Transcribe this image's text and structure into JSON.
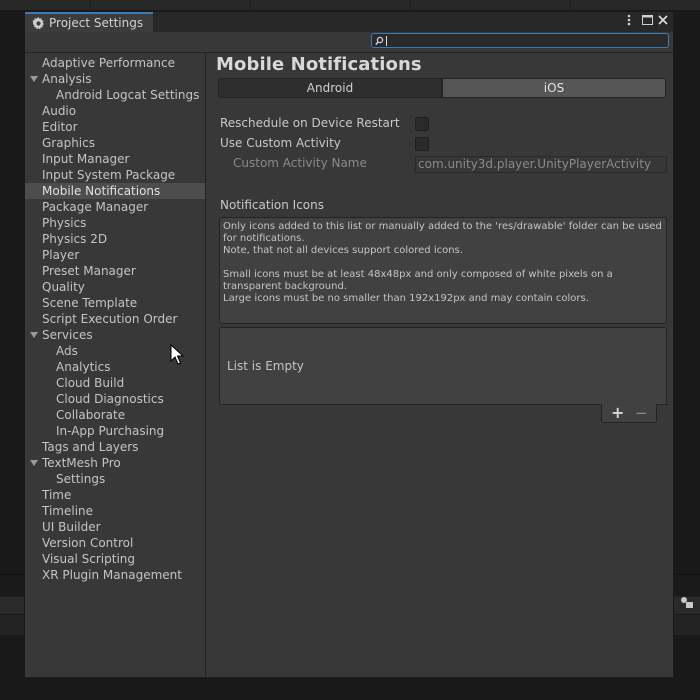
{
  "window": {
    "title": "Project Settings",
    "menu_icon": "more-vert-icon",
    "maximize_icon": "maximize-icon",
    "close_icon": "close-icon"
  },
  "search": {
    "value": "",
    "placeholder": ""
  },
  "sidebar": {
    "items": [
      {
        "label": "Adaptive Performance"
      },
      {
        "label": "Analysis",
        "expanded": true
      },
      {
        "label": "Android Logcat Settings"
      },
      {
        "label": "Audio"
      },
      {
        "label": "Editor"
      },
      {
        "label": "Graphics"
      },
      {
        "label": "Input Manager"
      },
      {
        "label": "Input System Package"
      },
      {
        "label": "Mobile Notifications",
        "selected": true
      },
      {
        "label": "Package Manager"
      },
      {
        "label": "Physics"
      },
      {
        "label": "Physics 2D"
      },
      {
        "label": "Player"
      },
      {
        "label": "Preset Manager"
      },
      {
        "label": "Quality"
      },
      {
        "label": "Scene Template"
      },
      {
        "label": "Script Execution Order"
      },
      {
        "label": "Services",
        "expanded": true
      },
      {
        "label": "Ads"
      },
      {
        "label": "Analytics"
      },
      {
        "label": "Cloud Build"
      },
      {
        "label": "Cloud Diagnostics"
      },
      {
        "label": "Collaborate"
      },
      {
        "label": "In-App Purchasing"
      },
      {
        "label": "Tags and Layers"
      },
      {
        "label": "TextMesh Pro",
        "expanded": true
      },
      {
        "label": "Settings"
      },
      {
        "label": "Time"
      },
      {
        "label": "Timeline"
      },
      {
        "label": "UI Builder"
      },
      {
        "label": "Version Control"
      },
      {
        "label": "Visual Scripting"
      },
      {
        "label": "XR Plugin Management"
      }
    ]
  },
  "main": {
    "title": "Mobile Notifications",
    "tabs": [
      {
        "label": "Android",
        "active": true
      },
      {
        "label": "iOS",
        "active": false
      }
    ],
    "fields": {
      "reschedule_label": "Reschedule on Device Restart",
      "reschedule_checked": false,
      "custom_activity_label": "Use Custom Activity",
      "custom_activity_checked": false,
      "activity_name_label": "Custom Activity Name",
      "activity_name_value": "com.unity3d.player.UnityPlayerActivity"
    },
    "icons_section": {
      "label": "Notification Icons",
      "help_lines": [
        "Only icons added to this list or manually added to the 'res/drawable' folder can be used for notifications.",
        "Note, that not all devices support colored icons.",
        "",
        "Small icons must be at least 48x48px and only composed of white pixels on a transparent background.",
        "Large icons must be no smaller than 192x192px and may contain colors."
      ],
      "list_empty_text": "List is Empty",
      "add_label": "+",
      "remove_label": "−"
    }
  },
  "colors": {
    "accent": "#3a79bb",
    "panel": "#383838",
    "selected_row": "#4d4d4d"
  }
}
